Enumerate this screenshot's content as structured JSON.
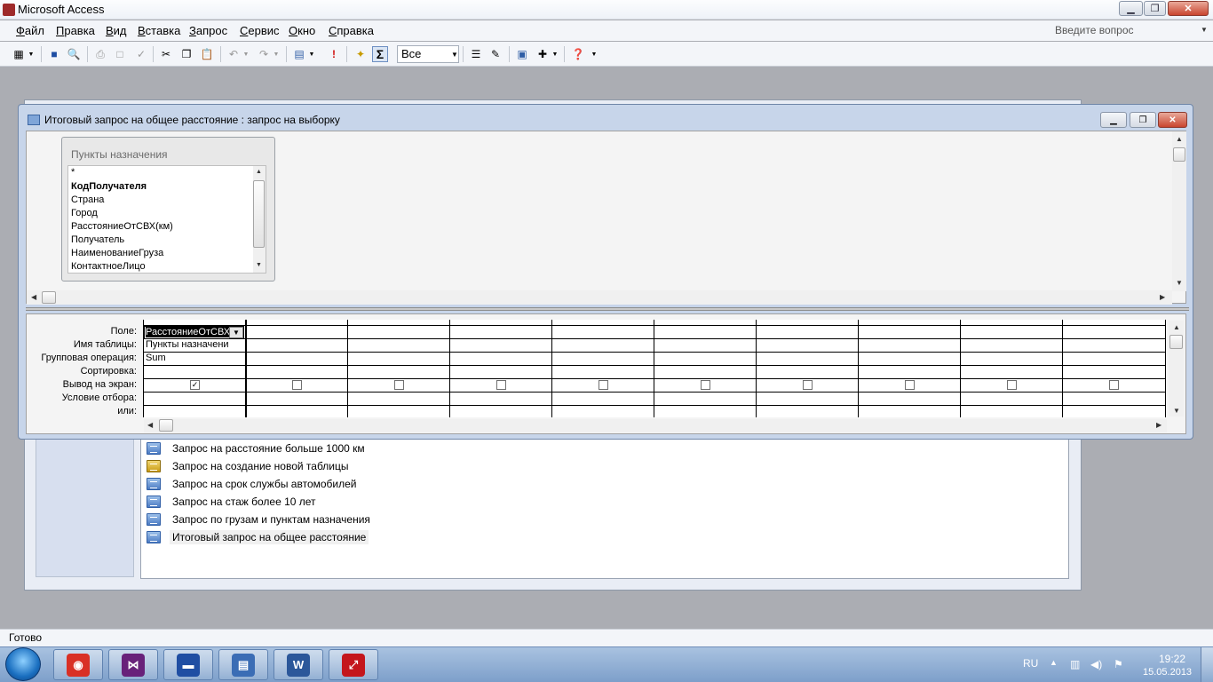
{
  "app": {
    "title": "Microsoft Access",
    "caption_buttons": {
      "minimize": "▁",
      "maximize": "❐",
      "close": "✕"
    }
  },
  "menu": {
    "items": [
      {
        "label": "Файл"
      },
      {
        "label": "Правка"
      },
      {
        "label": "Вид"
      },
      {
        "label": "Вставка"
      },
      {
        "label": "Запрос"
      },
      {
        "label": "Сервис"
      },
      {
        "label": "Окно"
      },
      {
        "label": "Справка"
      }
    ],
    "ask_placeholder": "Введите вопрос"
  },
  "toolbar": {
    "sum_label": "Σ",
    "topvalues_value": "Все"
  },
  "query_window": {
    "title": "Итоговый запрос на общее расстояние : запрос на выборку",
    "table": {
      "title": "Пункты назначения",
      "fields": [
        {
          "name": "*",
          "bold": false
        },
        {
          "name": "КодПолучателя",
          "bold": true
        },
        {
          "name": "Страна",
          "bold": false
        },
        {
          "name": "Город",
          "bold": false
        },
        {
          "name": "РасстояниеОтСВХ(км)",
          "bold": false
        },
        {
          "name": "Получатель",
          "bold": false
        },
        {
          "name": "НаименованиеГруза",
          "bold": false
        },
        {
          "name": "КонтактноеЛицо",
          "bold": false
        }
      ]
    },
    "grid": {
      "row_labels": {
        "field": "Поле:",
        "table": "Имя таблицы:",
        "total": "Групповая операция:",
        "sort": "Сортировка:",
        "show": "Вывод на экран:",
        "criteria": "Условие отбора:",
        "or": "или:"
      },
      "column1": {
        "field": "РасстояниеОтСВХ(",
        "table": "Пункты назначени",
        "total": "Sum",
        "show": true
      },
      "column_count": 10
    }
  },
  "database_window": {
    "objects": [
      {
        "label": "Запрос на расстояние больше 1000 км",
        "kind": "select-query",
        "selected": false
      },
      {
        "label": "Запрос на создание новой таблицы",
        "kind": "make-table-query",
        "selected": false
      },
      {
        "label": "Запрос на срок службы автомобилей",
        "kind": "select-query",
        "selected": false
      },
      {
        "label": "Запрос на стаж более 10 лет",
        "kind": "select-query",
        "selected": false
      },
      {
        "label": "Запрос по грузам и пунктам назначения",
        "kind": "select-query",
        "selected": false
      },
      {
        "label": "Итоговый запрос на общее расстояние",
        "kind": "select-query",
        "selected": true
      }
    ]
  },
  "statusbar": {
    "text": "Готово"
  },
  "taskbar": {
    "apps": [
      {
        "name": "chrome-icon",
        "color": "#d93025"
      },
      {
        "name": "visual-studio-icon",
        "color": "#68217a"
      },
      {
        "name": "save-disk-icon",
        "color": "#1f4ea3"
      },
      {
        "name": "access-forms-icon",
        "color": "#3b6db5"
      },
      {
        "name": "word-icon",
        "color": "#2b579a"
      },
      {
        "name": "pdf-icon",
        "color": "#c4161c"
      }
    ],
    "tray": {
      "lang": "RU",
      "time": "19:22",
      "date": "15.05.2013"
    }
  }
}
